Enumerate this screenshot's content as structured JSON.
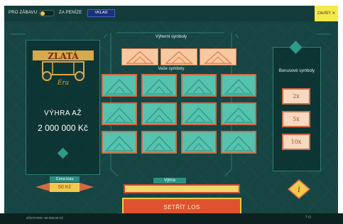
{
  "topbar": {
    "play_fun_label": "PRO ZÁBAVU",
    "play_money_label": "ZA PENÍZE",
    "login_label": "VKLAD",
    "close_label": "ZAVŘÍT ✕"
  },
  "game": {
    "logo_text": "ZLATÁ",
    "logo_subtext": "Éra",
    "win_label": "VÝHRA AŽ",
    "win_amount": "2 000 000 Kč",
    "price_label": "Cena losu",
    "price_value": "50 Kč"
  },
  "sections": {
    "winning_symbols": "Výherní symboly",
    "your_symbols": "Vaše symboly",
    "bonus_symbols": "Bonusové symboly",
    "win_field_label": "Výhra"
  },
  "bonus": [
    "2x",
    "5x",
    "10x"
  ],
  "scratch_label": "SETŘÍT LOS",
  "footer": {
    "balance": "ZŮSTATEK: 50 000,00 Kč",
    "icons": "?   ⏻"
  },
  "colors": {
    "background": "#164543",
    "accent_gold": "#f2c94c",
    "accent_orange": "#e0522f",
    "tile_border": "#d26a44"
  }
}
